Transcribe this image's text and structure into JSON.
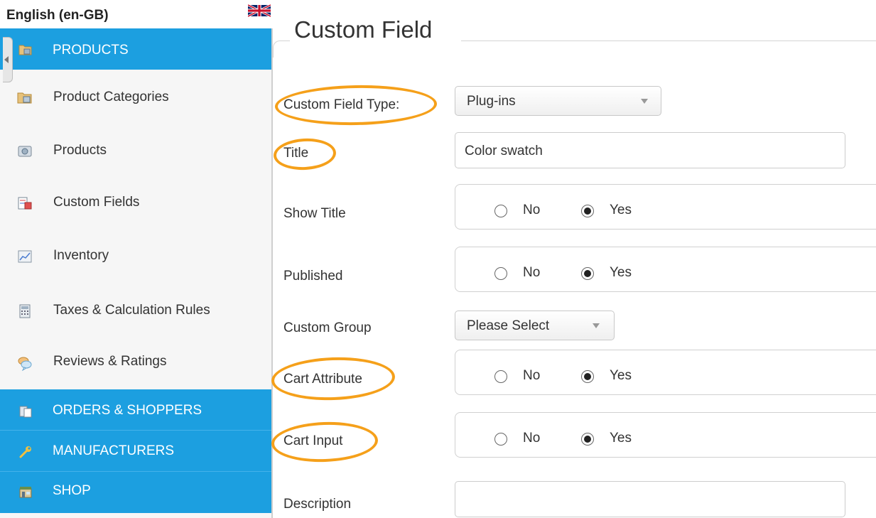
{
  "sidebar": {
    "language": "English (en-GB)",
    "flag_icon": "uk-flag-icon",
    "sections": {
      "products": {
        "label": "PRODUCTS",
        "icon": "products-folder-icon"
      },
      "orders": {
        "label": "ORDERS & SHOPPERS",
        "icon": "orders-icon"
      },
      "manufacturers": {
        "label": "MANUFACTURERS",
        "icon": "wrench-icon"
      },
      "shop": {
        "label": "SHOP",
        "icon": "shop-icon"
      }
    },
    "items": [
      {
        "label": "Product Categories",
        "icon": "folder-icon"
      },
      {
        "label": "Products",
        "icon": "camera-icon"
      },
      {
        "label": "Custom Fields",
        "icon": "custom-fields-icon"
      },
      {
        "label": "Inventory",
        "icon": "chart-icon"
      },
      {
        "label": "Taxes & Calculation Rules",
        "icon": "calculator-icon"
      },
      {
        "label": "Reviews & Ratings",
        "icon": "speech-bubble-icon"
      }
    ],
    "accent_color": "#1c9fe0"
  },
  "main": {
    "title": "Custom Field",
    "highlight_color": "#f5a01a",
    "fields": {
      "type": {
        "label": "Custom Field Type:",
        "value": "Plug-ins"
      },
      "title": {
        "label": "Title",
        "value": "Color swatch"
      },
      "show_title": {
        "label": "Show Title",
        "no": "No",
        "yes": "Yes",
        "selected": "Yes"
      },
      "published": {
        "label": "Published",
        "no": "No",
        "yes": "Yes",
        "selected": "Yes"
      },
      "custom_group": {
        "label": "Custom Group",
        "value": "Please Select"
      },
      "cart_attribute": {
        "label": "Cart Attribute",
        "no": "No",
        "yes": "Yes",
        "selected": "Yes"
      },
      "cart_input": {
        "label": "Cart Input",
        "no": "No",
        "yes": "Yes",
        "selected": "Yes"
      },
      "description": {
        "label": "Description",
        "value": ""
      }
    }
  }
}
